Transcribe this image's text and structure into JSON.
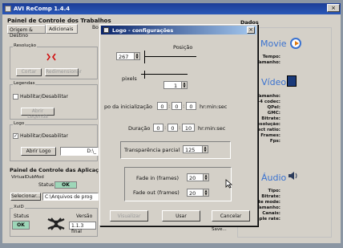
{
  "app": {
    "title": "AVI ReComp 1.4.4"
  },
  "window_controls": {
    "close": "×"
  },
  "left_panel": {
    "title": "Painel de Controle dos Trabalhos",
    "tabs": [
      "Origem & Destino",
      "Adicionais"
    ],
    "tab_partial": "Bo",
    "resolucao": {
      "label": "Resolução",
      "btn1": "Cortar",
      "btn2": "Redimensionar"
    },
    "legendas": {
      "label": "Legendas",
      "checkbox": "Habilitar/Desabilitar",
      "btn": "Abrir Legenda"
    },
    "logo": {
      "label": "Logo",
      "checkbox": "Habilitar/Desabilitar",
      "btn": "Abrir Logo",
      "path": "D:\\_"
    },
    "apps": {
      "title": "Painel de Controle das Aplicaç",
      "virtualdubmod": "VirtualDubMod",
      "status_label": "Status",
      "status_value": "OK",
      "select_btn": "Selecionar...",
      "path": "C:\\Arquivos de prog"
    },
    "xvid": {
      "label": "XviD",
      "status_label": "Status",
      "version_label": "Versão",
      "status_value": "OK",
      "version_value": "1.1.3 final"
    }
  },
  "right_panel": {
    "title": "Dados",
    "movie": {
      "heading": "Movie",
      "fields": [
        "Tempo:",
        "Tamanho:"
      ]
    },
    "video": {
      "heading": "Vídeo",
      "fields": [
        "Tamanho:",
        "-4 codec:",
        "QPel:",
        "GMC:",
        "Bitrate:",
        "esolução:",
        "pect ratio:",
        "Frames:",
        "Fps:"
      ]
    },
    "audio": {
      "heading": "Áudio",
      "fields": [
        "Tipo:",
        "Bitrate:",
        "te mode:",
        "Tamanho:",
        "Canais:",
        "Sample rate:"
      ]
    }
  },
  "dialog": {
    "title": "Logo - configurações",
    "close": "×",
    "posicao_label": "Posição",
    "posicao_value": "267",
    "pixels_label": "pixels",
    "pixels_value": "1",
    "inicializacao_label": "po da inicialização",
    "inicio_h": "0",
    "inicio_m": "0",
    "inicio_s": "0",
    "time_unit": "hr:min:sec",
    "duracao_label": "Duração",
    "dur_h": "0",
    "dur_m": "0",
    "dur_s": "10",
    "transparencia_label": "Transparência parcial",
    "transparencia_value": "125",
    "fadein_label": "Fade in (frames)",
    "fadein_value": "20",
    "fadeout_label": "Fade out (frames)",
    "fadeout_value": "20",
    "btn_visualizar": "Visualizar",
    "btn_usar": "Usar",
    "btn_cancelar": "Cancelar"
  },
  "bottom_partial": {
    "save": "Save..."
  }
}
